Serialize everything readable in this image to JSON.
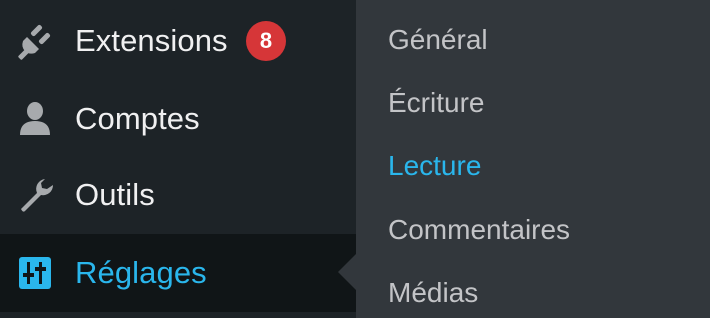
{
  "admin_menu": {
    "items": [
      {
        "label": "Extensions",
        "icon": "plug-icon",
        "badge": "8"
      },
      {
        "label": "Comptes",
        "icon": "user-icon"
      },
      {
        "label": "Outils",
        "icon": "wrench-icon"
      },
      {
        "label": "Réglages",
        "icon": "sliders-icon",
        "current": true
      }
    ]
  },
  "submenu": {
    "items": [
      {
        "label": "Général"
      },
      {
        "label": "Écriture"
      },
      {
        "label": "Lecture",
        "current": true
      },
      {
        "label": "Commentaires"
      },
      {
        "label": "Médias"
      }
    ]
  },
  "colors": {
    "menu_bg": "#1d2327",
    "menu_current_bg": "#101517",
    "submenu_bg": "#32373c",
    "accent": "#2ab6ec",
    "badge": "#d63638",
    "text": "#f0f0f1",
    "submenu_text": "#c3c4c7"
  }
}
